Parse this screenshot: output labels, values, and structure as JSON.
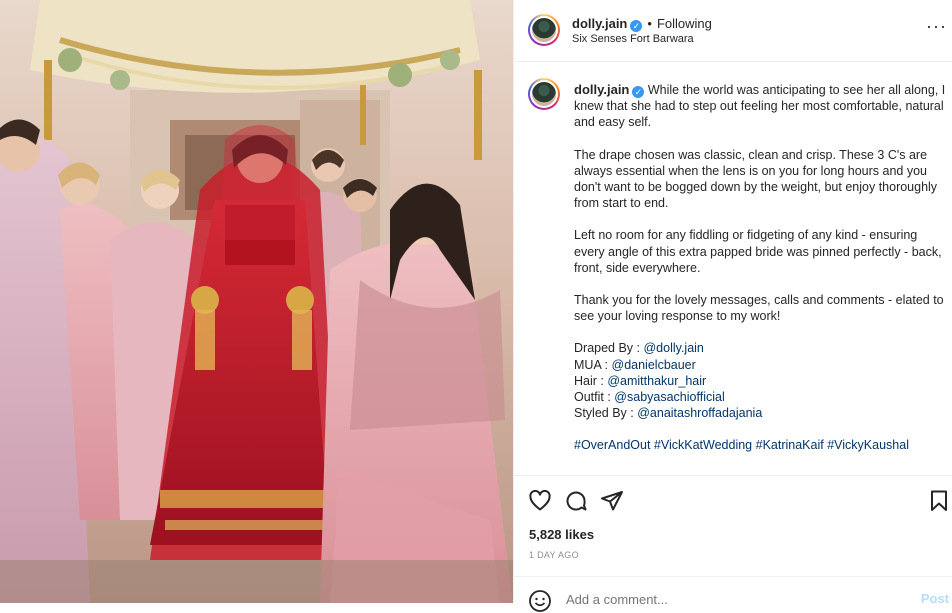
{
  "post": {
    "username": "dolly.jain",
    "verified_mark": "✓",
    "dot": "•",
    "follow_status": "Following",
    "location": "Six Senses Fort Barwara",
    "more_label": "···"
  },
  "caption": {
    "username": "dolly.jain",
    "para1": "While the world was anticipating to see her all along, I knew that she had to step out feeling her most comfortable, natural and easy self.",
    "para2": "The drape chosen was classic, clean and crisp. These 3 C's are always essential when the lens is on you for long hours and you don't want to be bogged down by the weight, but enjoy thoroughly from start to end.",
    "para3": "Left no room for any fiddling or fidgeting of any kind - ensuring every angle of this extra papped bride was pinned perfectly - back, front, side everywhere.",
    "para4": "Thank you for the lovely messages, calls and comments - elated to see your loving response to my work!",
    "credits": [
      {
        "label": "Draped By : ",
        "handle": "@dolly.jain"
      },
      {
        "label": "MUA : ",
        "handle": "@danielcbauer"
      },
      {
        "label": "Hair : ",
        "handle": "@amitthakur_hair"
      },
      {
        "label": "Outfit : ",
        "handle": "@sabyasachiofficial"
      },
      {
        "label": "Styled By : ",
        "handle": "@anaitashroffadajania"
      }
    ],
    "hashtags": [
      "#OverAndOut",
      "#VickKatWedding",
      "#KatrinaKaif",
      "#VickyKaushal"
    ]
  },
  "actions": {
    "likes": "5,828 likes",
    "time": "1 DAY AGO",
    "comment_placeholder": "Add a comment...",
    "post_label": "Post"
  },
  "icons": [
    "heart-icon",
    "comment-icon",
    "share-icon",
    "bookmark-icon",
    "emoji-icon",
    "verified-icon",
    "more-icon"
  ],
  "colors": {
    "link": "#00376b",
    "verified": "#3897f0",
    "post_button": "#b2dffc",
    "muted": "#8e8e8e",
    "bridal_red": "#c0182a",
    "blush_pink": "#e8a9b0"
  }
}
